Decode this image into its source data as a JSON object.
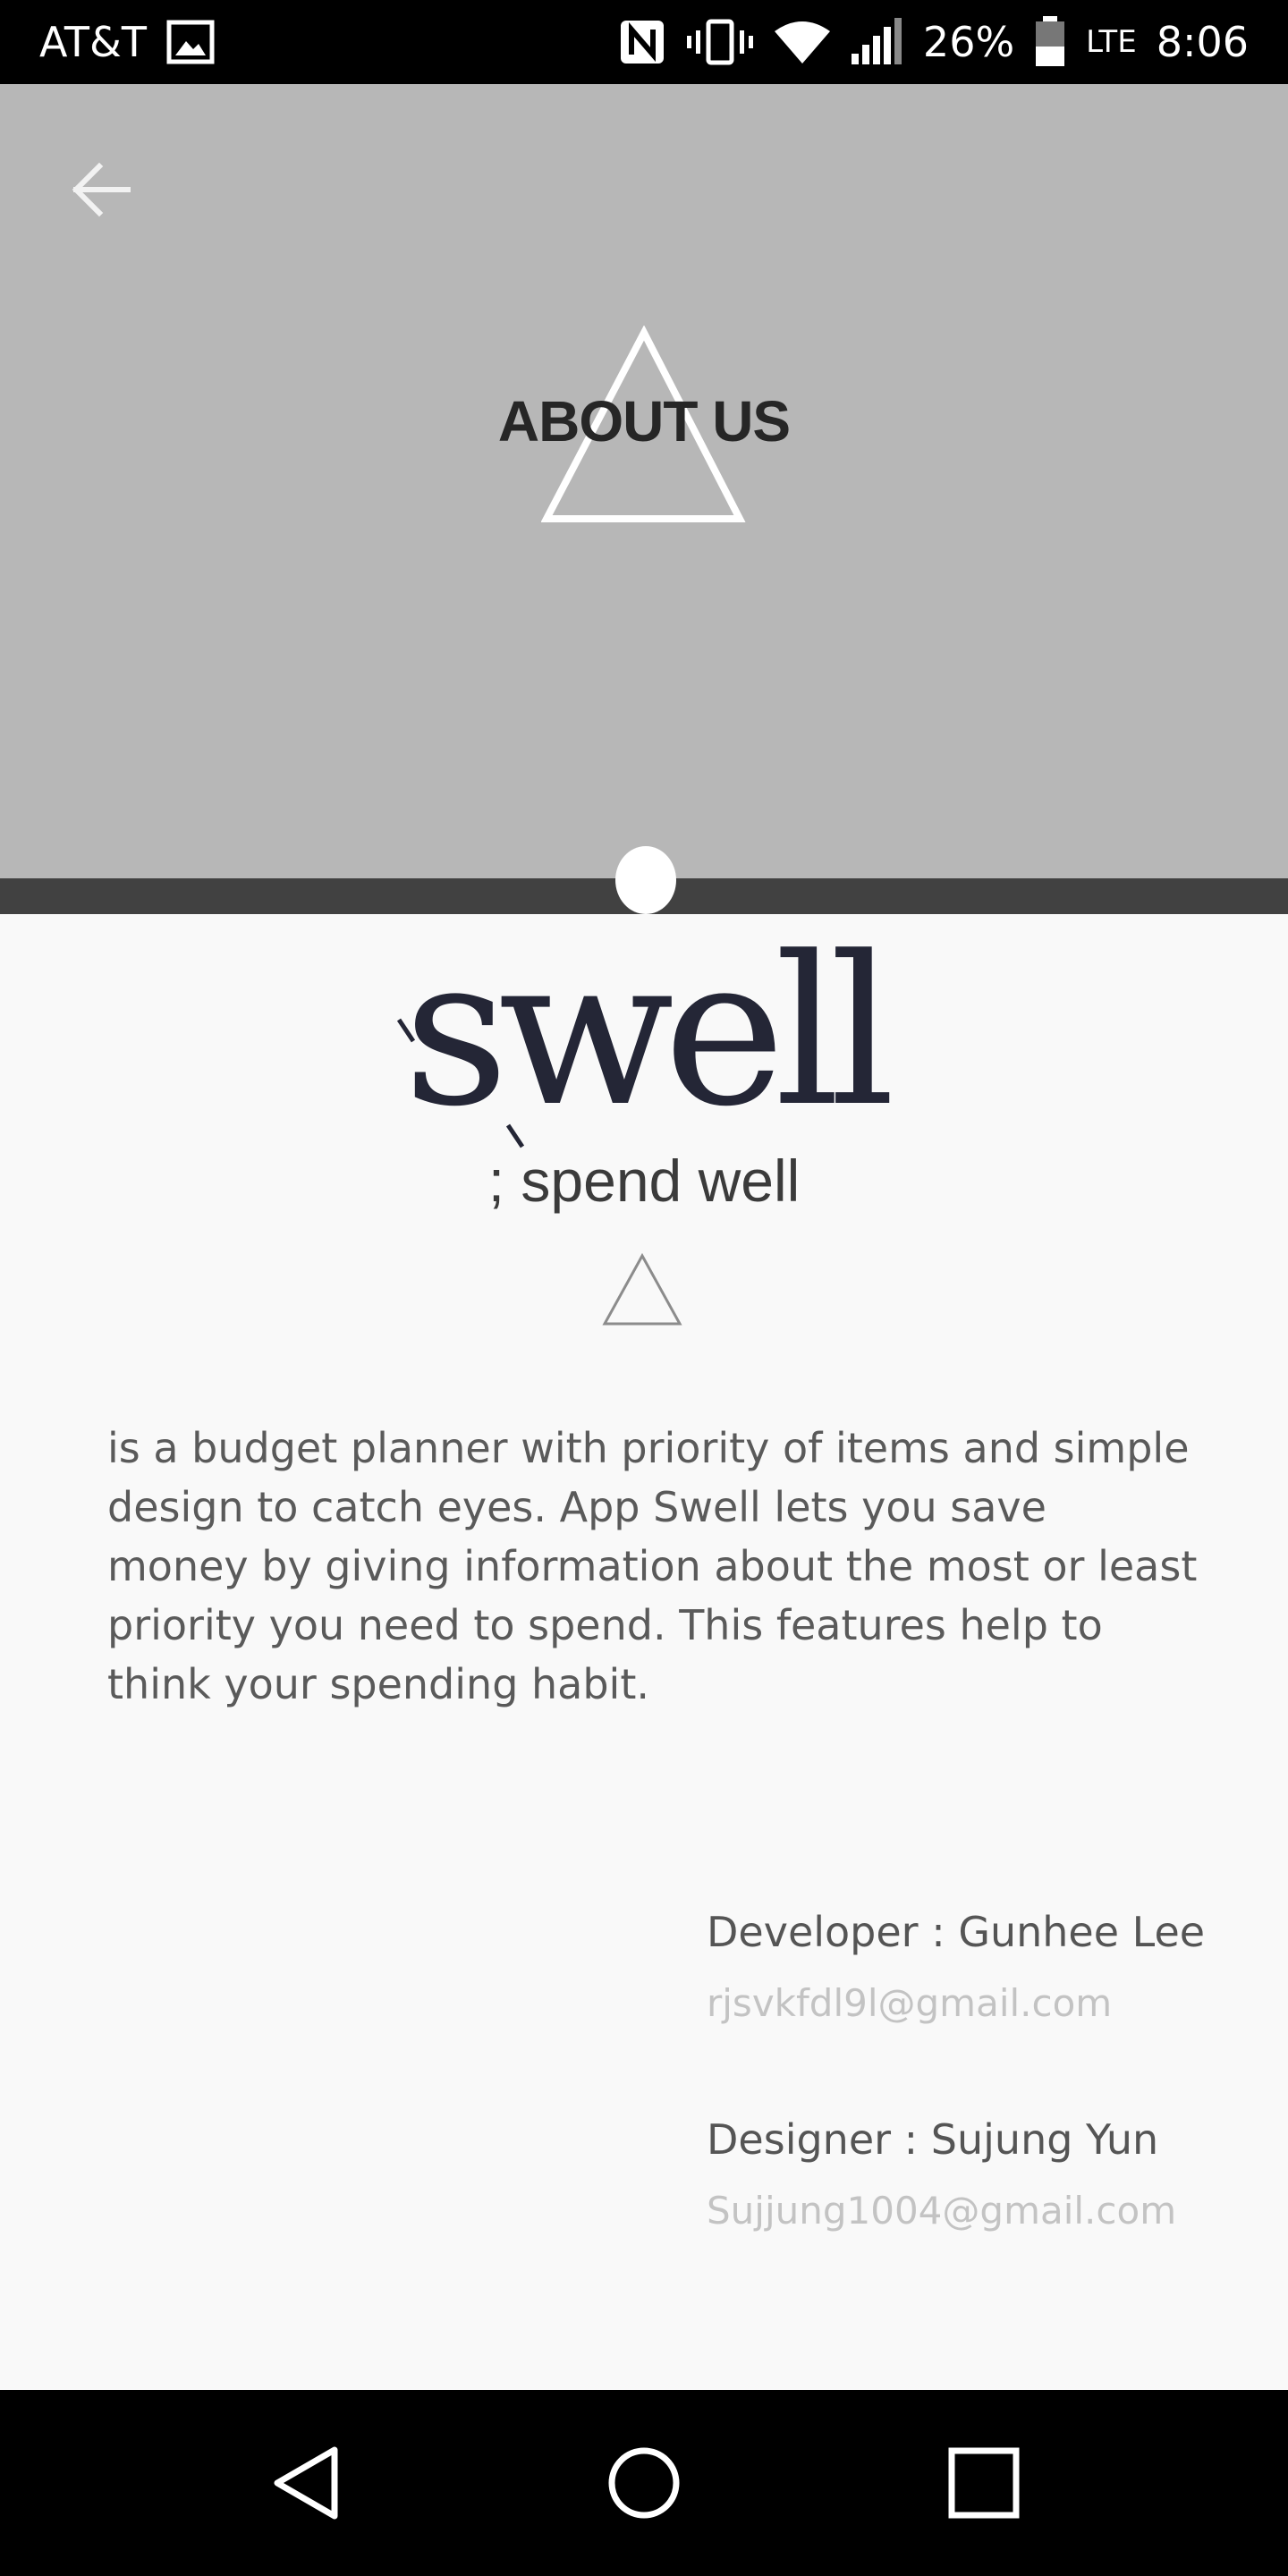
{
  "status_bar": {
    "carrier": "AT&T",
    "battery_percent": "26%",
    "time": "8:06",
    "network_label": "LTE",
    "icons": [
      "image-icon",
      "nfc-icon",
      "vibrate-icon",
      "wifi-icon",
      "signal-icon",
      "battery-icon"
    ]
  },
  "header": {
    "title": "ABOUT US",
    "back_icon": "arrow-left-icon"
  },
  "pager": {
    "active_index": 0
  },
  "logo": {
    "word": "swell",
    "tagline": "; spend well"
  },
  "description": "is a budget planner with priority of items and simple design to catch eyes. App Swell lets you save money by giving information about the most or least priority you need to spend. This features help to think your spending habit.",
  "credits": {
    "developer": "Developer : Gunhee Lee",
    "developer_email": "rjsvkfdl9l@gmail.com",
    "designer": "Designer : Sujung Yun",
    "designer_email": "Sujjung1004@gmail.com"
  },
  "colors": {
    "banner": "#b7b7b7",
    "strip": "#414141",
    "logo": "#242636",
    "background": "#f9f9f9"
  },
  "nav_bar": {
    "icons": [
      "back-triangle-icon",
      "home-circle-icon",
      "recents-square-icon"
    ]
  }
}
